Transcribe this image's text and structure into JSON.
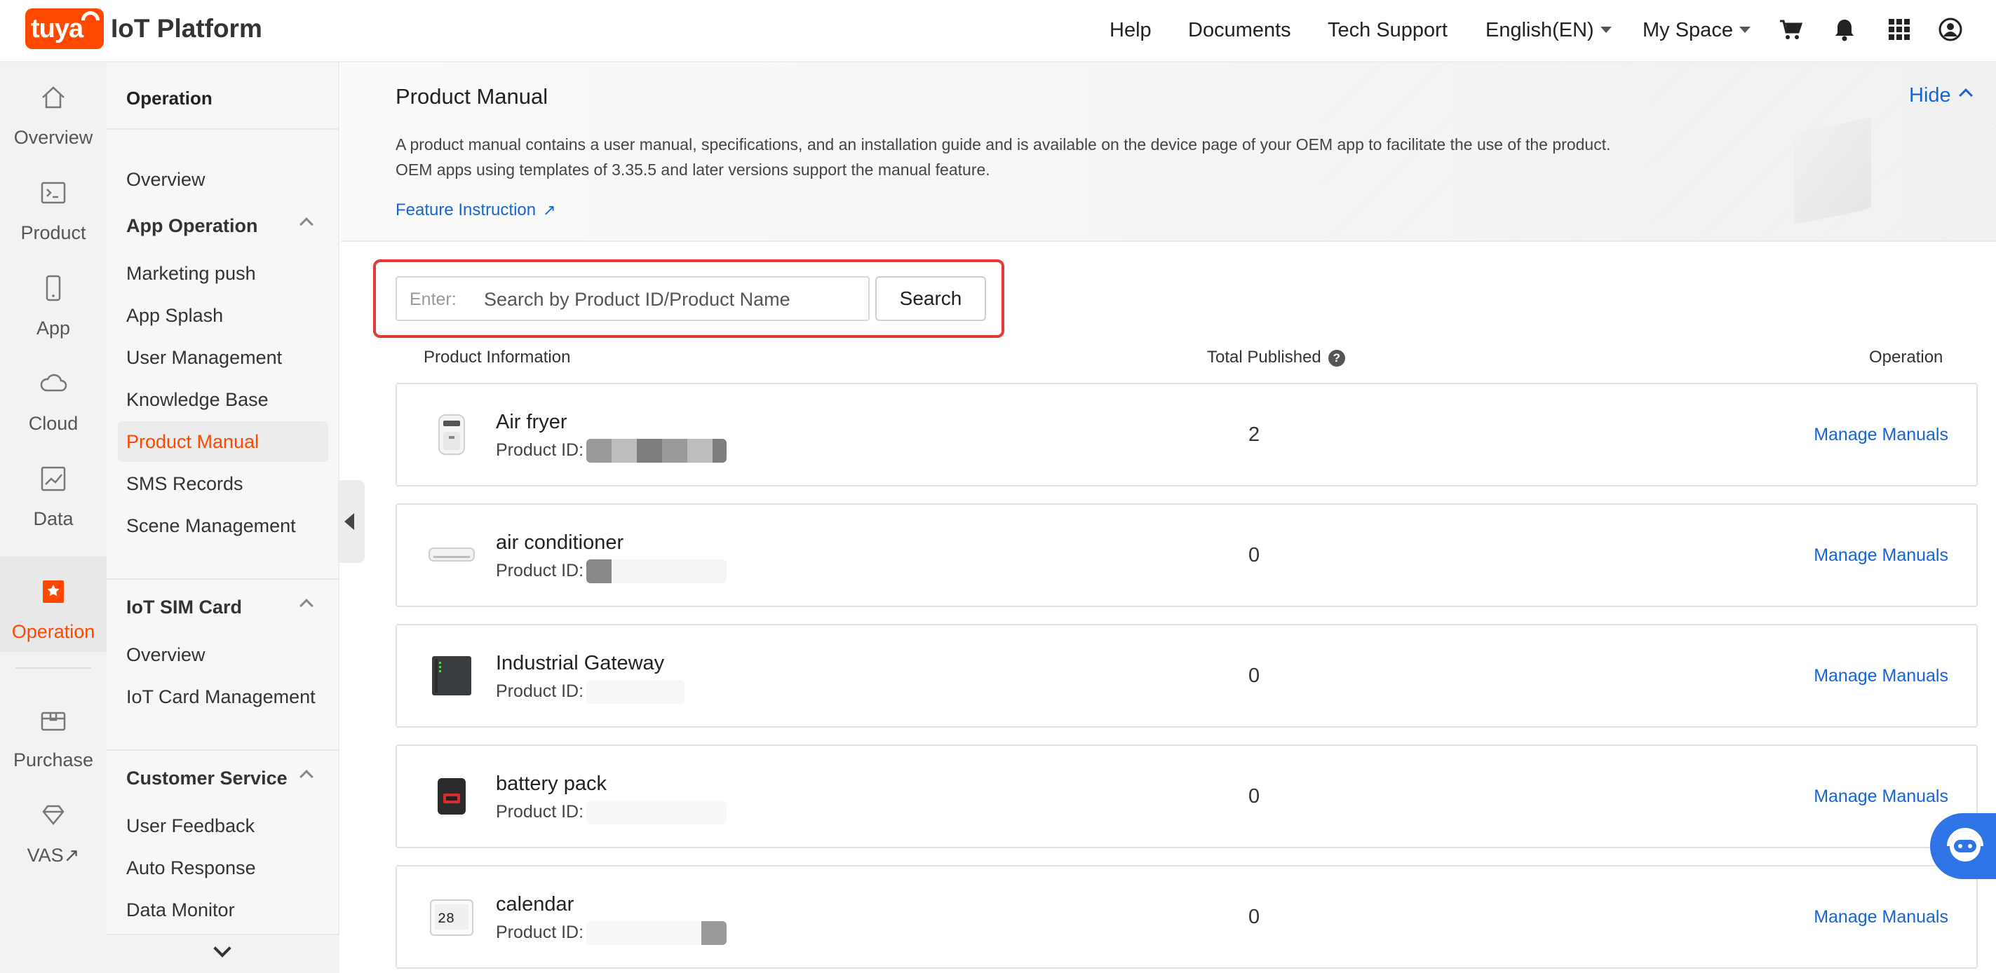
{
  "header": {
    "logo_badge": "tuya",
    "logo_text": "IoT Platform",
    "nav": [
      "Help",
      "Documents",
      "Tech Support"
    ],
    "language": "English(EN)",
    "space": "My Space",
    "icons": [
      "cart-icon",
      "bell-icon",
      "apps-grid-icon",
      "user-account-icon"
    ]
  },
  "rail": {
    "items": [
      {
        "label": "Overview",
        "icon": "home-icon"
      },
      {
        "label": "Product",
        "icon": "terminal-icon"
      },
      {
        "label": "App",
        "icon": "phone-icon"
      },
      {
        "label": "Cloud",
        "icon": "cloud-icon"
      },
      {
        "label": "Data",
        "icon": "chart-icon"
      },
      {
        "label": "Operation",
        "icon": "bookmark-icon",
        "active": true
      },
      {
        "label": "Purchase",
        "icon": "box-icon"
      },
      {
        "label": "VAS↗",
        "icon": "diamond-icon"
      }
    ]
  },
  "subnav": {
    "title": "Operation",
    "overview": "Overview",
    "groups": [
      {
        "label": "App Operation",
        "items": [
          "Marketing push",
          "App Splash",
          "User Management",
          "Knowledge Base",
          "Product Manual",
          "SMS Records",
          "Scene Management"
        ]
      },
      {
        "label": "IoT SIM Card",
        "items": [
          "Overview",
          "IoT Card Management"
        ]
      },
      {
        "label": "Customer Service",
        "items": [
          "User Feedback",
          "Auto Response",
          "Data Monitor"
        ]
      }
    ],
    "active_item": "Product Manual"
  },
  "banner": {
    "title": "Product Manual",
    "hide": "Hide",
    "description_1": "A product manual contains a user manual, specifications, and an installation guide and is available on the device page of your OEM app to facilitate the use of the product.",
    "description_2": "OEM apps using templates of 3.35.5 and later versions support the manual feature.",
    "feature_link": "Feature Instruction"
  },
  "search": {
    "prefix": "Enter:",
    "placeholder": "Search by Product ID/Product Name",
    "value": "",
    "button": "Search"
  },
  "table": {
    "headers": [
      "Product Information",
      "Total Published",
      "Operation"
    ],
    "id_label": "Product ID:",
    "action": "Manage Manuals",
    "rows": [
      {
        "name": "Air fryer",
        "total": "2"
      },
      {
        "name": "air conditioner",
        "total": "0"
      },
      {
        "name": "Industrial Gateway",
        "total": "0"
      },
      {
        "name": "battery pack",
        "total": "0"
      },
      {
        "name": "calendar",
        "total": "0"
      }
    ]
  },
  "colors": {
    "brand": "#ff4800",
    "link": "#1565d8",
    "highlight_frame": "#e53935"
  }
}
